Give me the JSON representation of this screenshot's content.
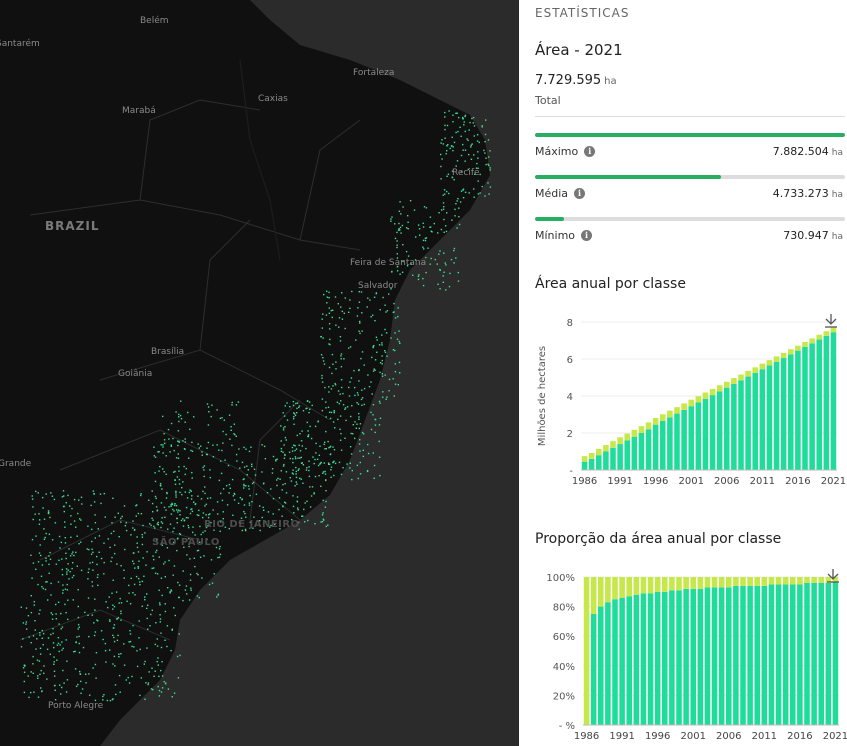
{
  "map": {
    "labels": [
      {
        "text": "Belém",
        "cls": "city"
      },
      {
        "text": "Santarém",
        "cls": "city"
      },
      {
        "text": "Fortaleza",
        "cls": "city"
      },
      {
        "text": "Marabá",
        "cls": "city"
      },
      {
        "text": "Caxias",
        "cls": "city"
      },
      {
        "text": "Recife",
        "cls": "city"
      },
      {
        "text": "BRAZIL",
        "cls": "city big"
      },
      {
        "text": "Feira de Santana",
        "cls": "city"
      },
      {
        "text": "Salvador",
        "cls": "city"
      },
      {
        "text": "Brasília",
        "cls": "city"
      },
      {
        "text": "Goiânia",
        "cls": "city"
      },
      {
        "text": "Grande",
        "cls": "city"
      },
      {
        "text": "RIO DE JANEIRO",
        "cls": "city state"
      },
      {
        "text": "SÃO PAULO",
        "cls": "city state"
      },
      {
        "text": "Porto Alegre",
        "cls": "city"
      }
    ]
  },
  "panel": {
    "section_title": "ESTATÍSTICAS",
    "area_title": "Área - 2021",
    "total_value": "7.729.595",
    "unit": "ha",
    "total_label": "Total",
    "stats": [
      {
        "label": "Máximo",
        "value": "7.882.504",
        "fraction": 1.0
      },
      {
        "label": "Média",
        "value": "4.733.273",
        "fraction": 0.6
      },
      {
        "label": "Mínimo",
        "value": "730.947",
        "fraction": 0.093
      }
    ],
    "accent": "#27ae60"
  },
  "chart_data": [
    {
      "type": "bar",
      "title": "Área anual por classe",
      "ylabel": "Milhões de hectares",
      "ylim": [
        0,
        8
      ],
      "yticks": [
        "-",
        "2",
        "4",
        "6",
        "8"
      ],
      "xticks": [
        "1986",
        "1991",
        "1996",
        "2001",
        "2006",
        "2011",
        "2016",
        "2021"
      ],
      "categories": [
        "1986",
        "1987",
        "1988",
        "1989",
        "1990",
        "1991",
        "1992",
        "1993",
        "1994",
        "1995",
        "1996",
        "1997",
        "1998",
        "1999",
        "2000",
        "2001",
        "2002",
        "2003",
        "2004",
        "2005",
        "2006",
        "2007",
        "2008",
        "2009",
        "2010",
        "2011",
        "2012",
        "2013",
        "2014",
        "2015",
        "2016",
        "2017",
        "2018",
        "2019",
        "2020",
        "2021"
      ],
      "series": [
        {
          "color": "#1fdc9a",
          "values": [
            0.45,
            0.6,
            0.8,
            1.0,
            1.2,
            1.4,
            1.6,
            1.8,
            2.0,
            2.2,
            2.45,
            2.65,
            2.85,
            3.05,
            3.25,
            3.45,
            3.65,
            3.85,
            4.05,
            4.25,
            4.45,
            4.65,
            4.85,
            5.05,
            5.25,
            5.45,
            5.65,
            5.85,
            6.05,
            6.25,
            6.45,
            6.65,
            6.85,
            7.05,
            7.25,
            7.45
          ]
        },
        {
          "color": "#c6e84a",
          "values": [
            0.3,
            0.32,
            0.34,
            0.35,
            0.36,
            0.37,
            0.37,
            0.37,
            0.37,
            0.37,
            0.36,
            0.36,
            0.36,
            0.35,
            0.35,
            0.35,
            0.34,
            0.34,
            0.33,
            0.33,
            0.32,
            0.32,
            0.31,
            0.31,
            0.3,
            0.3,
            0.29,
            0.29,
            0.28,
            0.28,
            0.27,
            0.27,
            0.26,
            0.26,
            0.25,
            0.25
          ]
        }
      ]
    },
    {
      "type": "bar",
      "title": "Proporção da área anual por classe",
      "ylim": [
        0,
        100
      ],
      "yticks": [
        "- %",
        "20%",
        "40%",
        "60%",
        "80%",
        "100%"
      ],
      "xticks": [
        "1986",
        "1991",
        "1996",
        "2001",
        "2006",
        "2011",
        "2016",
        "2021"
      ],
      "categories": [
        "1986",
        "1987",
        "1988",
        "1989",
        "1990",
        "1991",
        "1992",
        "1993",
        "1994",
        "1995",
        "1996",
        "1997",
        "1998",
        "1999",
        "2000",
        "2001",
        "2002",
        "2003",
        "2004",
        "2005",
        "2006",
        "2007",
        "2008",
        "2009",
        "2010",
        "2011",
        "2012",
        "2013",
        "2014",
        "2015",
        "2016",
        "2017",
        "2018",
        "2019",
        "2020",
        "2021"
      ],
      "series": [
        {
          "color": "#1fdc9a",
          "values": [
            0,
            75,
            80,
            83,
            85,
            86,
            87,
            88,
            89,
            89,
            90,
            90,
            91,
            91,
            92,
            92,
            92,
            93,
            93,
            93,
            93,
            94,
            94,
            94,
            94,
            94,
            95,
            95,
            95,
            95,
            95,
            96,
            96,
            96,
            96,
            97
          ]
        },
        {
          "color": "#c6e84a",
          "values": [
            100,
            25,
            20,
            17,
            15,
            14,
            13,
            12,
            11,
            11,
            10,
            10,
            9,
            9,
            8,
            8,
            8,
            7,
            7,
            7,
            7,
            6,
            6,
            6,
            6,
            6,
            5,
            5,
            5,
            5,
            5,
            4,
            4,
            4,
            4,
            3
          ]
        }
      ]
    }
  ]
}
